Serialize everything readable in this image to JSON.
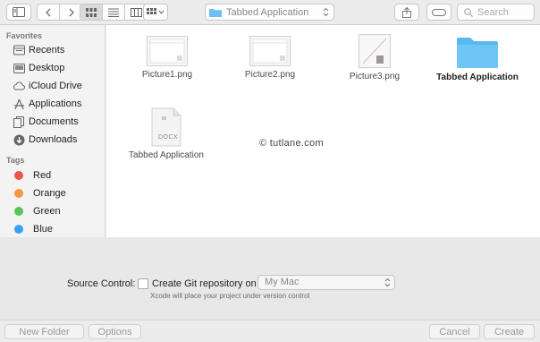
{
  "toolbar": {
    "path_label": "Tabbed Application",
    "search_placeholder": "Search",
    "icons": [
      "sidebar-toggle-icon",
      "back-icon",
      "forward-icon",
      "icon-view-icon",
      "list-view-icon",
      "column-view-icon",
      "group-by-icon",
      "share-icon",
      "tag-icon",
      "search-icon"
    ]
  },
  "sidebar": {
    "favorites_heading": "Favorites",
    "favorites": [
      {
        "label": "Recents",
        "icon": "clock-icon"
      },
      {
        "label": "Desktop",
        "icon": "desktop-icon"
      },
      {
        "label": "iCloud Drive",
        "icon": "cloud-icon"
      },
      {
        "label": "Applications",
        "icon": "applications-icon"
      },
      {
        "label": "Documents",
        "icon": "documents-icon"
      },
      {
        "label": "Downloads",
        "icon": "download-icon"
      }
    ],
    "tags_heading": "Tags",
    "tags": [
      {
        "label": "Red",
        "color": "#e9574c"
      },
      {
        "label": "Orange",
        "color": "#f59a3c"
      },
      {
        "label": "Green",
        "color": "#5cc35b"
      },
      {
        "label": "Blue",
        "color": "#3d9ff3"
      }
    ]
  },
  "files": [
    {
      "name": "Picture1.png",
      "type": "image"
    },
    {
      "name": "Picture2.png",
      "type": "image"
    },
    {
      "name": "Picture3.png",
      "type": "image"
    },
    {
      "name": "Tabbed Application",
      "type": "folder"
    },
    {
      "name": "Tabbed Application",
      "type": "docx",
      "badge": "DOCX"
    }
  ],
  "watermark": "© tutlane.com",
  "options": {
    "source_control_label": "Source Control:",
    "checkbox_label": "Create Git repository on",
    "checkbox_checked": false,
    "location_value": "My Mac",
    "hint": "Xcode will place your project under version control"
  },
  "footer": {
    "new_folder": "New Folder",
    "options": "Options",
    "cancel": "Cancel",
    "create": "Create"
  },
  "colors": {
    "folder_blue": "#5ab8f0",
    "window_bg": "#ececec",
    "content_bg": "#ffffff"
  }
}
